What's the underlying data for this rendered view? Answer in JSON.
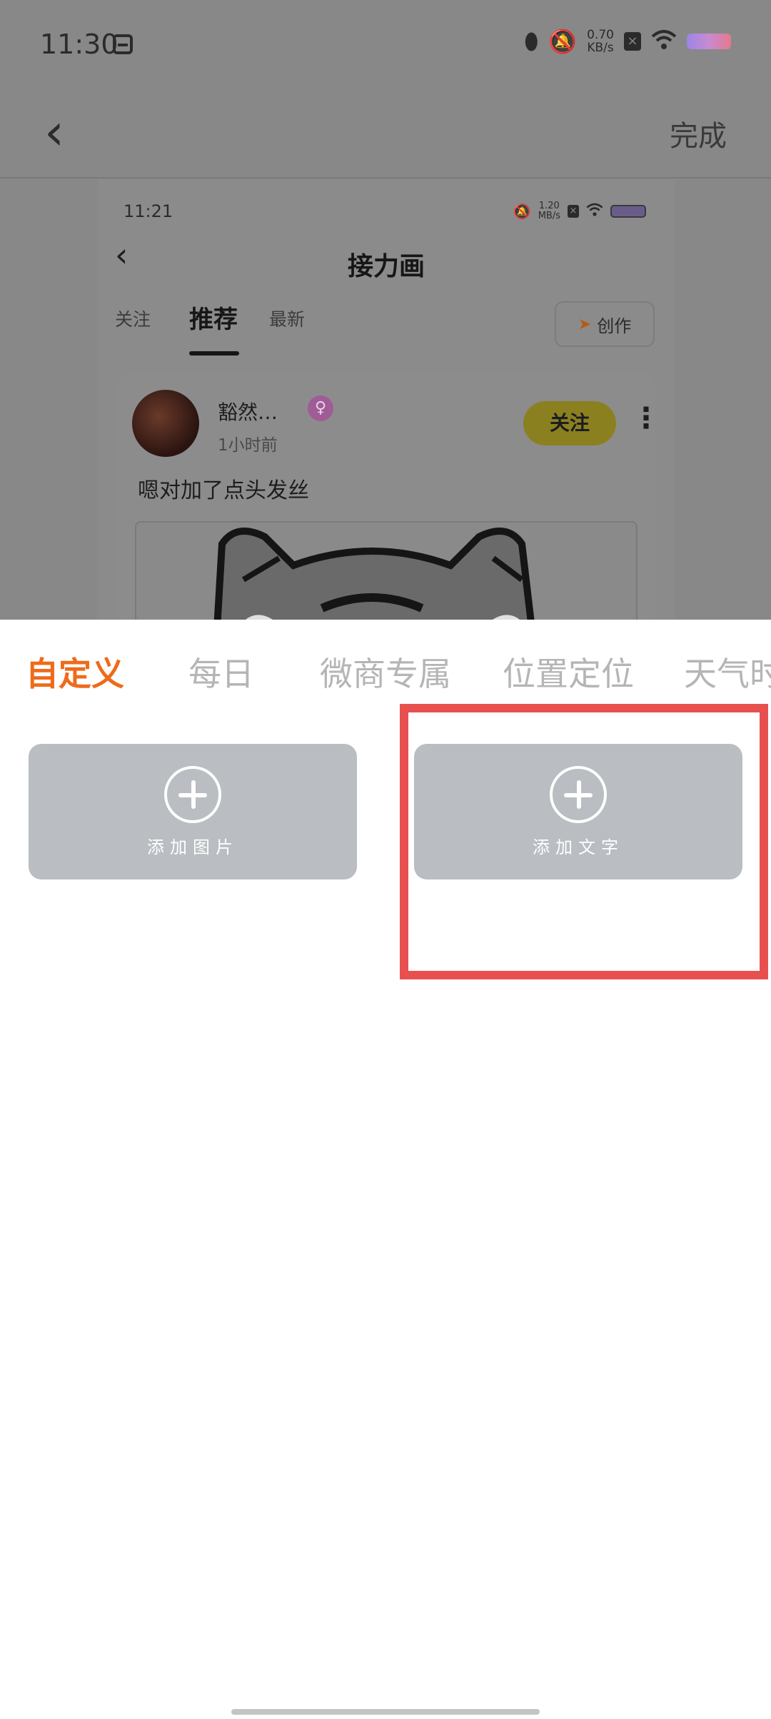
{
  "status_bar": {
    "time": "11:30",
    "speed_value": "0.70",
    "speed_unit": "KB/s",
    "icons": [
      "gallery-icon",
      "location-icon",
      "mute-icon",
      "sim-x-icon",
      "wifi-icon",
      "battery-icon"
    ]
  },
  "header": {
    "back_icon": "chevron-left-icon",
    "done_label": "完成"
  },
  "preview": {
    "time": "11:21",
    "speed_value": "1.20",
    "speed_unit": "MB/s",
    "title": "接力画",
    "tabs": [
      {
        "label": "关注"
      },
      {
        "label": "推荐",
        "active": true
      },
      {
        "label": "最新"
      }
    ],
    "create_label": "创作",
    "post": {
      "author": "豁然…",
      "time_ago": "1小时前",
      "follow_label": "关注",
      "content": "嗯对加了点头发丝"
    }
  },
  "sheet": {
    "categories": [
      {
        "label": "自定义",
        "active": true
      },
      {
        "label": "每日"
      },
      {
        "label": "微商专属"
      },
      {
        "label": "位置定位"
      },
      {
        "label": "天气时"
      }
    ],
    "tiles": [
      {
        "label": "添加图片",
        "icon": "plus-circle-icon"
      },
      {
        "label": "添加文字",
        "icon": "plus-circle-icon"
      }
    ]
  },
  "colors": {
    "accent": "#ee6b1a",
    "highlight": "#e8504f",
    "tile": "#babdc1",
    "dim_overlay": "#888888"
  }
}
